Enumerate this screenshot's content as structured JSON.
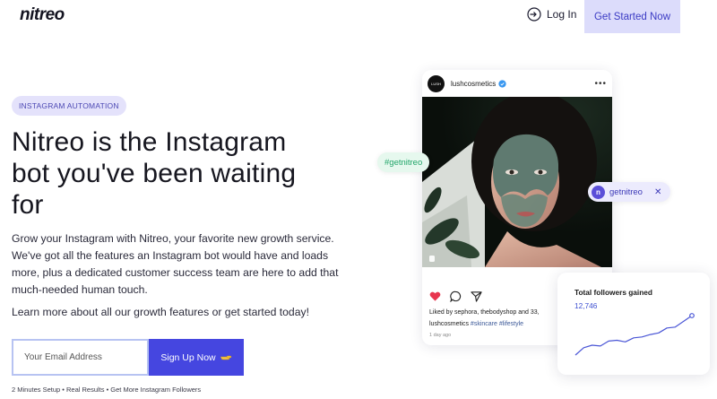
{
  "header": {
    "logo": "nitreo",
    "login_label": "Log In",
    "cta_label": "Get Started Now"
  },
  "hero": {
    "pill": "INSTAGRAM AUTOMATION",
    "headline": "Nitreo is the Instagram bot you've been waiting for",
    "description": "Grow your Instagram with Nitreo, your favorite new growth service. We've got all the features an Instagram bot would have and loads more, plus a dedicated customer success team are here to add that much-needed human touch.",
    "cta_text": "Learn more about all our growth features or get started today!",
    "email_placeholder": "Your Email Address",
    "signup_label": "Sign Up Now",
    "footnote": "2 Minutes Setup • Real Results • Get More Instagram Followers"
  },
  "instagram_post": {
    "avatar_text": "LUSH",
    "username": "lushcosmetics",
    "likes": "Liked by sephora, thebodyshop and 33,",
    "caption_user": "lushcosmetics",
    "caption_tags": "#skincare #lifestyle",
    "date": "1 day ago"
  },
  "chips": {
    "green": "#getnitreo",
    "purple": "getnitreo",
    "purple_icon_letter": "n"
  },
  "followers_card": {
    "title": "Total followers gained",
    "value": "12,746"
  },
  "chart_data": {
    "type": "line",
    "x": [
      0,
      1,
      2,
      3,
      4,
      5,
      6,
      7,
      8,
      9,
      10,
      11,
      12,
      13,
      14
    ],
    "values": [
      0,
      9,
      12,
      11,
      17,
      18,
      16,
      21,
      22,
      25,
      27,
      33,
      34,
      41,
      48
    ],
    "color": "#4a56d6"
  },
  "colors": {
    "accent": "#4546e0",
    "pill_bg": "#e4e2fb",
    "green_chip": "#22a66a"
  }
}
